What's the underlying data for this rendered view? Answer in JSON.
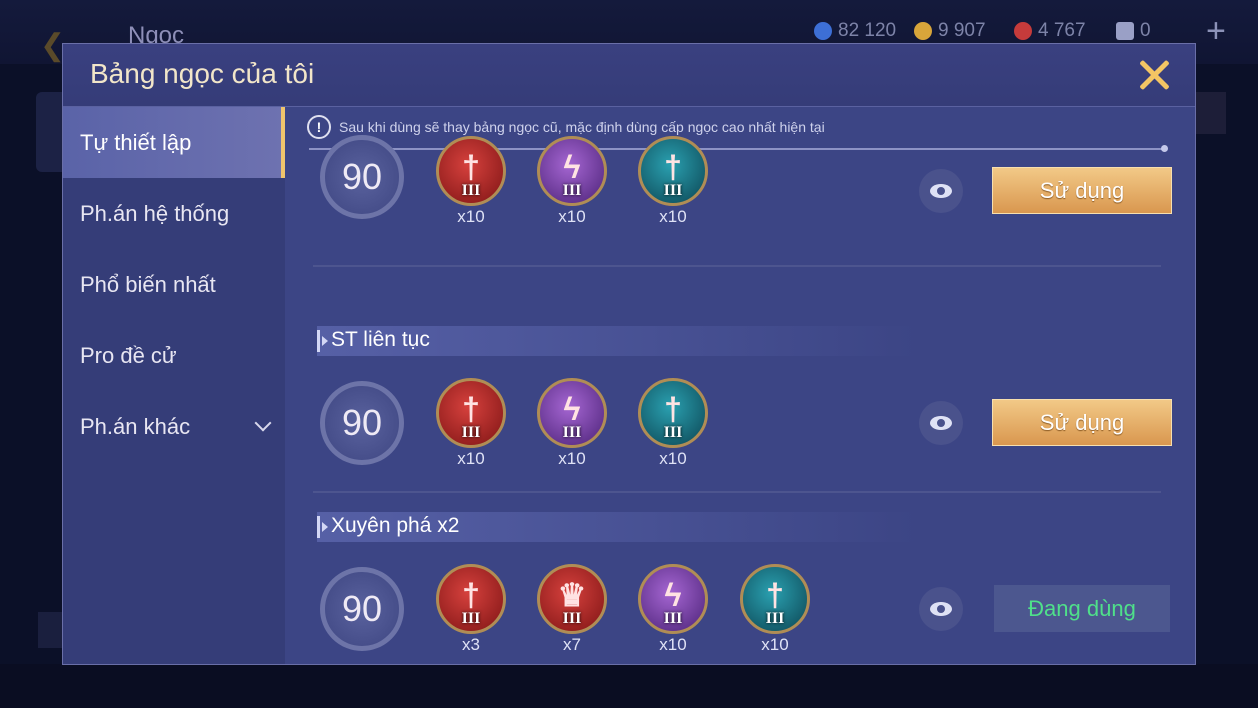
{
  "background": {
    "screen_title": "Ngọc",
    "resources": [
      {
        "icon": "blue-gem-icon",
        "value": "82 120",
        "color": "#3d6fd6"
      },
      {
        "icon": "gold-coin-icon",
        "value": "9 907",
        "color": "#d8a53a"
      },
      {
        "icon": "red-crystal-icon",
        "value": "4 767",
        "color": "#c63b3b"
      },
      {
        "icon": "card-icon",
        "value": "0",
        "color": "#9aa0c6"
      }
    ],
    "plus_label": "+"
  },
  "modal": {
    "title": "Bảng ngọc của tôi"
  },
  "sidebar": {
    "items": [
      {
        "label": "Tự thiết lập",
        "active": true
      },
      {
        "label": "Ph.án hệ thống",
        "active": false
      },
      {
        "label": "Phổ biến nhất",
        "active": false
      },
      {
        "label": "Pro đề cử",
        "active": false
      },
      {
        "label": "Ph.án khác",
        "active": false,
        "expandable": true
      }
    ]
  },
  "notice": {
    "icon": "!",
    "text": "Sau khi dùng sẽ thay bảng ngọc cũ, mặc định dùng cấp ngọc cao nhất hiện tại"
  },
  "rows": [
    {
      "level": "90",
      "gems": [
        {
          "color": "red",
          "glyph": "†",
          "tier": "III",
          "qty": "x10"
        },
        {
          "color": "purple",
          "glyph": "ϟ",
          "tier": "III",
          "qty": "x10"
        },
        {
          "color": "teal",
          "glyph": "†",
          "tier": "III",
          "qty": "x10"
        }
      ],
      "button": "Sử dụng"
    },
    {
      "section": "ST liên tục",
      "level": "90",
      "gems": [
        {
          "color": "red",
          "glyph": "†",
          "tier": "III",
          "qty": "x10"
        },
        {
          "color": "purple",
          "glyph": "ϟ",
          "tier": "III",
          "qty": "x10"
        },
        {
          "color": "teal",
          "glyph": "†",
          "tier": "III",
          "qty": "x10"
        }
      ],
      "button": "Sử dụng"
    },
    {
      "section": "Xuyên phá x2",
      "level": "90",
      "gems": [
        {
          "color": "red",
          "glyph": "†",
          "tier": "III",
          "qty": "x3"
        },
        {
          "color": "red",
          "glyph": "♛",
          "tier": "III",
          "qty": "x7"
        },
        {
          "color": "purple",
          "glyph": "ϟ",
          "tier": "III",
          "qty": "x10"
        },
        {
          "color": "teal",
          "glyph": "†",
          "tier": "III",
          "qty": "x10"
        }
      ],
      "button": "Đang dùng"
    }
  ]
}
